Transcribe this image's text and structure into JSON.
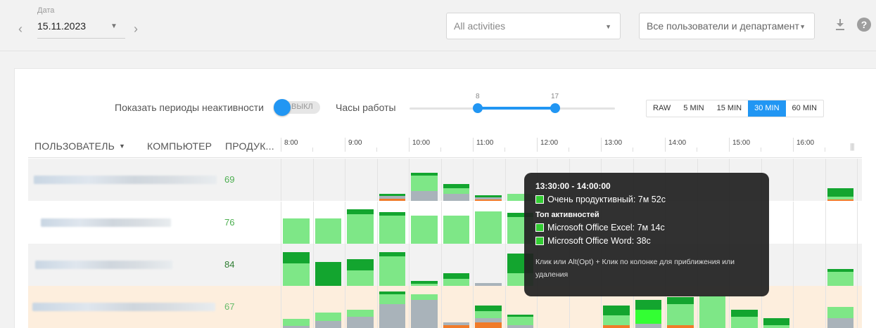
{
  "header": {
    "date_label": "Дата",
    "date_value": "15.11.2023",
    "activities_select": "All activities",
    "users_select": "Все пользователи и департамент",
    "prev_icon": "chevron-left-icon",
    "next_icon": "chevron-right-icon",
    "download_icon": "download-icon",
    "help_icon": "help-icon",
    "help_glyph": "?"
  },
  "controls": {
    "toggle_label": "Показать периоды неактивности",
    "toggle_state": "ВЫКЛ",
    "hours_label": "Часы работы",
    "hours_start": "8",
    "hours_end": "17",
    "intervals": [
      "RAW",
      "5 MIN",
      "15 MIN",
      "30 MIN",
      "60 MIN"
    ],
    "active_interval": "30 MIN"
  },
  "table": {
    "col_user": "ПОЛЬЗОВАТЕЛЬ",
    "col_computer": "КОМПЬЮТЕР",
    "col_prod": "ПРОДУК...",
    "hours": [
      "8:00",
      "9:00",
      "10:00",
      "11:00",
      "12:00",
      "13:00",
      "14:00",
      "15:00",
      "16:00"
    ],
    "rows": [
      {
        "score": "69",
        "score_color": "#4caf50",
        "bg": "#f2f2f2"
      },
      {
        "score": "76",
        "score_color": "#4caf50",
        "bg": "#ffffff"
      },
      {
        "score": "84",
        "score_color": "#2e7d32",
        "bg": "#f2f2f2"
      },
      {
        "score": "67",
        "score_color": "#66bb6a",
        "bg": "#fdeedd"
      }
    ]
  },
  "tooltip": {
    "time": "13:30:00 - 14:00:00",
    "productive": "Очень продуктивный: 7м 52с",
    "top_heading": "Топ активностей",
    "activity_1": "Microsoft Office Excel: 7м 14с",
    "activity_2": "Microsoft Office Word: 38с",
    "hint": "Клик или Alt(Opt) + Клик по колонке для приближения или удаления"
  },
  "colors": {
    "accent": "#2196f3",
    "very_productive": "#7ee787",
    "very_productive_dark": "#13a52f",
    "neutral": "#a9b3ba",
    "unproductive": "#f07b2a",
    "highlight": "#33ff33"
  }
}
